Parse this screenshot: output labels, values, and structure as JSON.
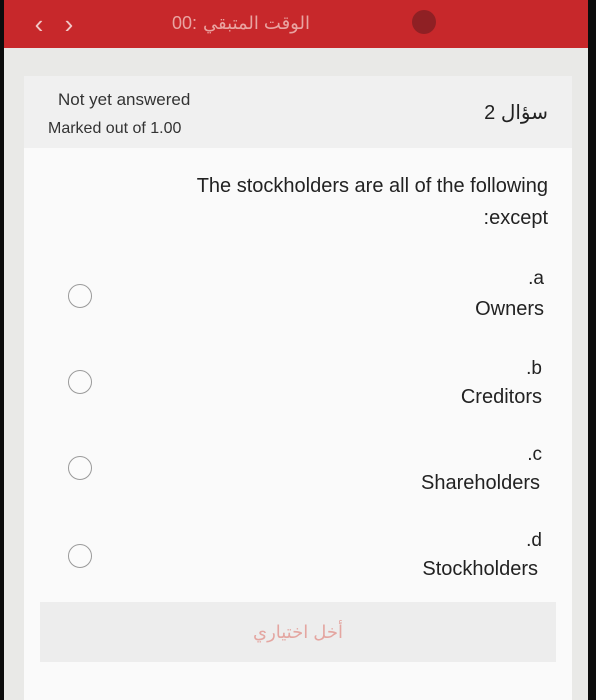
{
  "header": {
    "back_icon": "chevron-left-icon",
    "forward_icon": "chevron-right-icon",
    "timer_value": "00:",
    "timer_label": "الوقت المتبقي",
    "accent": "#c7282b"
  },
  "question": {
    "number_label": "سؤال 2",
    "state": "Not yet answered",
    "grade": "Marked out of 1.00",
    "text_line1": "The stockholders are all of the following",
    "text_line2": ":except",
    "options": [
      {
        "letter": ".a",
        "text": "Owners"
      },
      {
        "letter": ".b",
        "text": "Creditors"
      },
      {
        "letter": ".c",
        "text": "Shareholders"
      },
      {
        "letter": ".d",
        "text": "Stockholders"
      }
    ]
  },
  "footer": {
    "clear_label": "أخل اختياري"
  }
}
